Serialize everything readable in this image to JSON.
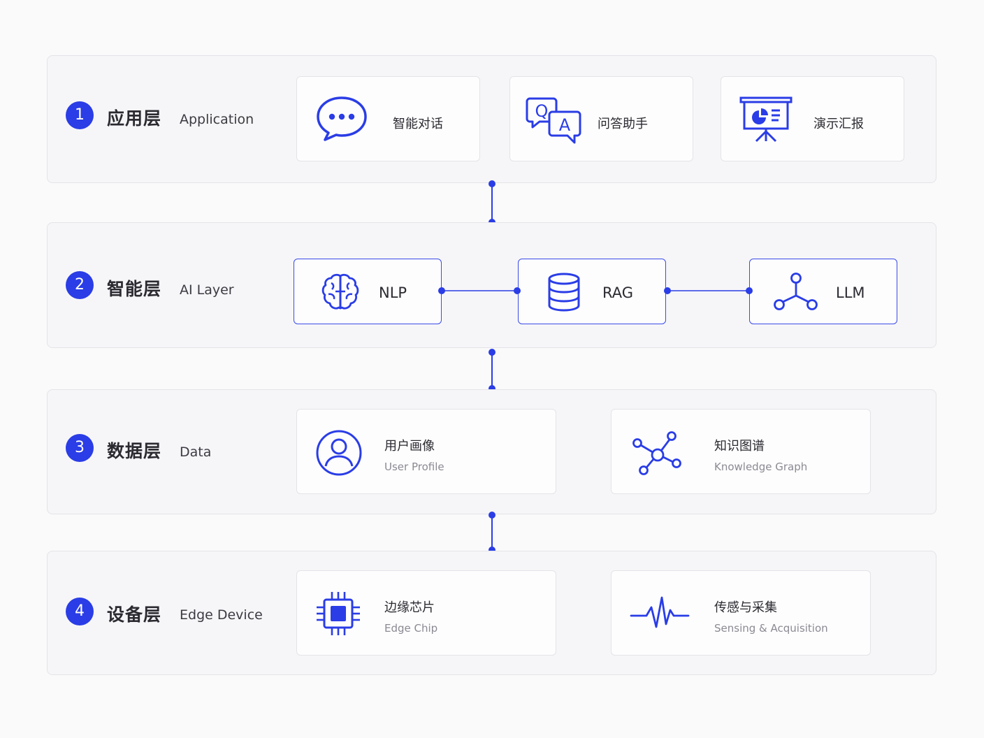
{
  "layers": [
    {
      "number": "1",
      "name_cn": "应用层",
      "name_en": "Application",
      "cards": [
        {
          "label": "智能对话",
          "icon": "chat-bubble-icon"
        },
        {
          "label": "问答助手",
          "icon": "qa-icon"
        },
        {
          "label": "演示汇报",
          "icon": "presentation-icon"
        }
      ]
    },
    {
      "number": "2",
      "name_cn": "智能层",
      "name_en": "AI Layer",
      "cards": [
        {
          "label": "NLP",
          "icon": "brain-icon"
        },
        {
          "label": "RAG",
          "icon": "database-icon"
        },
        {
          "label": "LLM",
          "icon": "network-nodes-icon"
        }
      ]
    },
    {
      "number": "3",
      "name_cn": "数据层",
      "name_en": "Data",
      "cards": [
        {
          "title": "用户画像",
          "subtitle": "User Profile",
          "icon": "user-profile-icon"
        },
        {
          "title": "知识图谱",
          "subtitle": "Knowledge Graph",
          "icon": "knowledge-graph-icon"
        }
      ]
    },
    {
      "number": "4",
      "name_cn": "设备层",
      "name_en": "Edge Device",
      "cards": [
        {
          "title": "边缘芯片",
          "subtitle": "Edge Chip",
          "icon": "chip-icon"
        },
        {
          "title": "传感与采集",
          "subtitle": "Sensing & Acquisition",
          "icon": "waveform-icon"
        }
      ]
    }
  ],
  "colors": {
    "accent": "#2a3de6",
    "card_border": "#e4e4e8",
    "panel_bg": "#f6f6f8"
  }
}
